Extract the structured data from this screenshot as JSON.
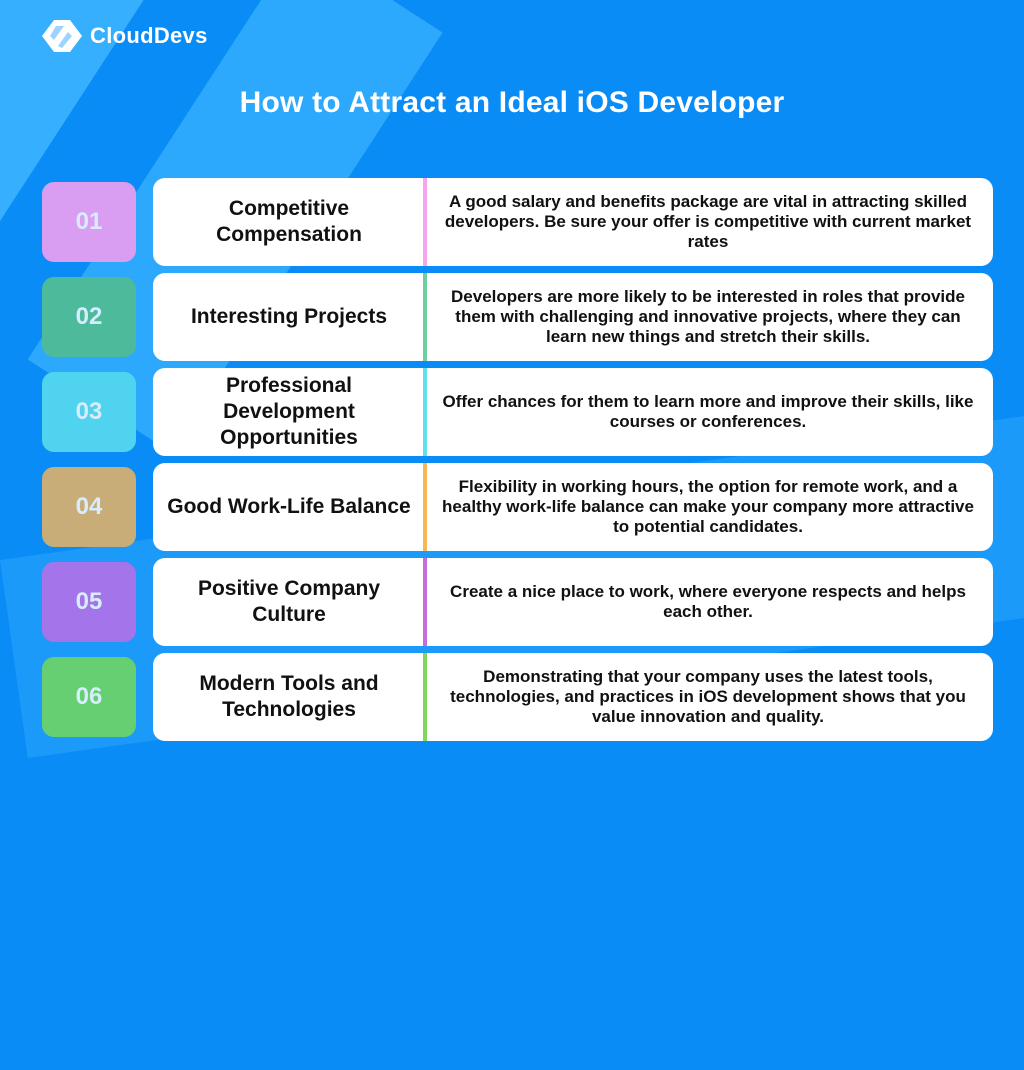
{
  "brand": {
    "name": "CloudDevs",
    "icon": "clouddevs-logo-icon"
  },
  "title": "How to Attract an Ideal iOS Developer",
  "colors": {
    "background": "#0a8cf6",
    "card": "#ffffff"
  },
  "items": [
    {
      "number": "01",
      "name": "Competitive Compensation",
      "description": "A good salary and benefits package are vital in attracting skilled developers. Be sure your offer is competitive with current market rates",
      "badge_color": "#d99df2",
      "line_color": "#f7a4f0"
    },
    {
      "number": "02",
      "name": "Interesting Projects",
      "description": "Developers are more likely to be interested in roles that provide them with challenging and innovative projects, where they can learn new things and stretch their skills.",
      "badge_color": "#4dbb9b",
      "line_color": "#6ecf9e"
    },
    {
      "number": "03",
      "name": "Professional Development Opportunities",
      "description": "Offer chances for them to learn more and improve their skills, like courses or conferences.",
      "badge_color": "#4fd3ee",
      "line_color": "#5fe0ea"
    },
    {
      "number": "04",
      "name": "Good Work-Life Balance",
      "description": "Flexibility in working hours, the option for remote work, and a healthy work-life balance can make your company more attractive to potential candidates.",
      "badge_color": "#c8ad78",
      "line_color": "#f9b654"
    },
    {
      "number": "05",
      "name": "Positive Company Culture",
      "description": "Create a nice place to work, where everyone respects and helps each other.",
      "badge_color": "#a374ea",
      "line_color": "#c86ad9"
    },
    {
      "number": "06",
      "name": "Modern Tools and Technologies",
      "description": "Demonstrating that your company uses the latest tools, technologies, and practices in iOS development shows that you value innovation and quality.",
      "badge_color": "#66cf71",
      "line_color": "#7fd85a"
    }
  ]
}
